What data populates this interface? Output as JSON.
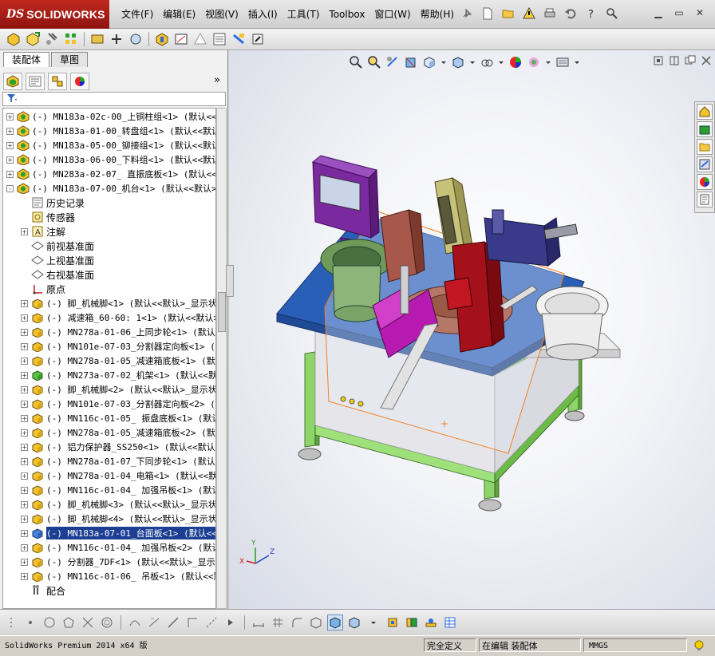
{
  "app": {
    "logo_ds": "DS",
    "logo_name": "SOLIDWORKS"
  },
  "menu": [
    "文件(F)",
    "编辑(E)",
    "视图(V)",
    "插入(I)",
    "工具(T)",
    "Toolbox",
    "窗口(W)",
    "帮助(H)"
  ],
  "left_panel": {
    "tabs": [
      "装配体",
      "草图"
    ],
    "more_glyph": "»"
  },
  "tree": [
    {
      "text": "(-) MN183a-02c-00_上铜柱组<1> (默认<<默认",
      "level": 0,
      "expander": "+",
      "icon": "assembly"
    },
    {
      "text": "(-) MN183a-01-00_转盘组<1> (默认<<默认",
      "level": 0,
      "expander": "+",
      "icon": "assembly"
    },
    {
      "text": "(-) MN183a-05-00_铆接组<1> (默认<<默认",
      "level": 0,
      "expander": "+",
      "icon": "assembly"
    },
    {
      "text": "(-) MN183a-06-00_下料组<1> (默认<<默认",
      "level": 0,
      "expander": "+",
      "icon": "assembly"
    },
    {
      "text": "(-) MN283a-02-07_ 直振底板<1> (默认<<默",
      "level": 0,
      "expander": "+",
      "icon": "assembly"
    },
    {
      "text": "(-) MN183a-07-00_机台<1> (默认<<默认>_",
      "level": 0,
      "expander": "-",
      "icon": "assembly"
    },
    {
      "text": "历史记录",
      "level": 1,
      "expander": "",
      "icon": "history",
      "sub": true
    },
    {
      "text": "传感器",
      "level": 1,
      "expander": "",
      "icon": "sensor",
      "sub": true
    },
    {
      "text": "注解",
      "level": 1,
      "expander": "+",
      "icon": "annotation",
      "sub": true
    },
    {
      "text": "前视基准面",
      "level": 1,
      "expander": "",
      "icon": "plane",
      "sub": true
    },
    {
      "text": "上视基准面",
      "level": 1,
      "expander": "",
      "icon": "plane",
      "sub": true
    },
    {
      "text": "右视基准面",
      "level": 1,
      "expander": "",
      "icon": "plane",
      "sub": true
    },
    {
      "text": "原点",
      "level": 1,
      "expander": "",
      "icon": "origin",
      "sub": true
    },
    {
      "text": "(-) 脚_机械脚<1> (默认<<默认>_显示状",
      "level": 1,
      "expander": "+",
      "icon": "part"
    },
    {
      "text": "(-) 减速箱_60-60: 1<1> (默认<<默认>_",
      "level": 1,
      "expander": "+",
      "icon": "part"
    },
    {
      "text": "(-) MN278a-01-06_上同步轮<1> (默认<<默",
      "level": 1,
      "expander": "+",
      "icon": "part"
    },
    {
      "text": "(-) MN101e-07-03_分割器定向板<1> (默认",
      "level": 1,
      "expander": "+",
      "icon": "part"
    },
    {
      "text": "(-) MN278a-01-05_减速箱底板<1> (默认<<",
      "level": 1,
      "expander": "+",
      "icon": "part"
    },
    {
      "text": "(-) MN273a-07-02_机架<1> (默认<<默认>_",
      "level": 1,
      "expander": "+",
      "icon": "part-green"
    },
    {
      "text": "(-) 脚_机械脚<2> (默认<<默认>_显示状",
      "level": 1,
      "expander": "+",
      "icon": "part"
    },
    {
      "text": "(-) MN101e-07-03_分割器定向板<2> (默认",
      "level": 1,
      "expander": "+",
      "icon": "part"
    },
    {
      "text": "(-) MN116c-01-05_ 振盘底板<1> (默认<<",
      "level": 1,
      "expander": "+",
      "icon": "part"
    },
    {
      "text": "(-) MN278a-01-05_减速箱底板<2> (默认<<",
      "level": 1,
      "expander": "+",
      "icon": "part"
    },
    {
      "text": "(-) 铝力保护器_SS250<1> (默认<<默认>_",
      "level": 1,
      "expander": "+",
      "icon": "part"
    },
    {
      "text": "(-) MN278a-01-07_下同步轮<1> (默认<<默",
      "level": 1,
      "expander": "+",
      "icon": "part"
    },
    {
      "text": "(-) MN278a-01-04_电箱<1> (默认<<默认>_",
      "level": 1,
      "expander": "+",
      "icon": "part"
    },
    {
      "text": "(-) MN116c-01-04_ 加强吊板<1> (默认<<默",
      "level": 1,
      "expander": "+",
      "icon": "part"
    },
    {
      "text": "(-) 脚_机械脚<3> (默认<<默认>_显示状",
      "level": 1,
      "expander": "+",
      "icon": "part"
    },
    {
      "text": "(-) 脚_机械脚<4> (默认<<默认>_显示状",
      "level": 1,
      "expander": "+",
      "icon": "part"
    },
    {
      "text": "(-) MN183a-07-01_台面板<1> (默认<<默",
      "level": 1,
      "expander": "+",
      "icon": "part-blue",
      "selected": true
    },
    {
      "text": "(-) MN116c-01-04_ 加强吊板<2> (默认<<默",
      "level": 1,
      "expander": "+",
      "icon": "part"
    },
    {
      "text": "(-) 分割器_7DF<1> (默认<<默认>_显示状",
      "level": 1,
      "expander": "+",
      "icon": "part"
    },
    {
      "text": "(-) MN116c-01-06_ 吊板<1> (默认<<默认",
      "level": 1,
      "expander": "+",
      "icon": "part"
    },
    {
      "text": "配合",
      "level": 1,
      "expander": "",
      "icon": "mates",
      "sub": true
    }
  ],
  "status": {
    "product": "SolidWorks Premium 2014 x64 版",
    "definition": "完全定义",
    "editing": "在编辑 装配体",
    "units": "MMGS"
  },
  "colors": {
    "selection": "#1c3f94",
    "logo_red": "#b3231b",
    "table_blue": "#2a5fb8",
    "frame_green": "#8fd46a",
    "purple": "#7a2a9e",
    "dark_red": "#a5111a"
  }
}
